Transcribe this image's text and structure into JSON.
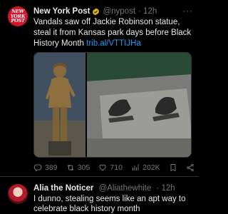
{
  "tweet": {
    "avatar_logo_lines": [
      "NEW",
      "YORK",
      "POST"
    ],
    "author_name": "New York Post",
    "handle": "@nypost",
    "time": "· 12h",
    "more_label": "···",
    "text_prefix": "Vandals saw off Jackie Robinson statue, steal it from Kansas park days before Black History Month ",
    "link": "trib.al/VTTIJHa",
    "stats": {
      "replies": "389",
      "retweets": "305",
      "likes": "710",
      "views": "202K"
    }
  },
  "reply": {
    "author_name": "Alia the Noticer",
    "handle": "@Aliathewhite",
    "time": "· 12h",
    "text": "I dunno, stealing seems like an apt way to celebrate black history month"
  },
  "colors": {
    "background": "#000000",
    "link": "#1d9bf0",
    "muted": "#71767b",
    "verified": "#e2b719",
    "nypost_red": "#d5142b"
  }
}
